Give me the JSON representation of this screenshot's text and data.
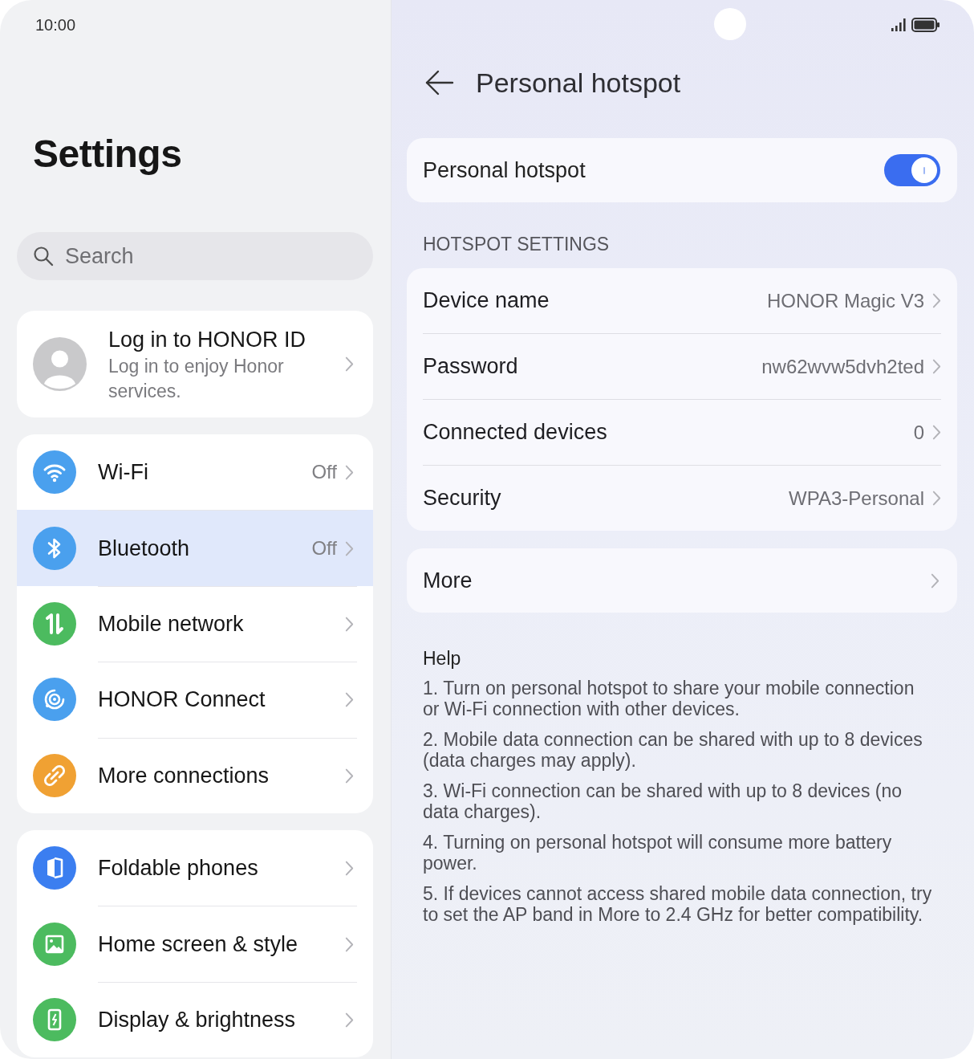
{
  "status_bar": {
    "time": "10:00"
  },
  "sidebar": {
    "title": "Settings",
    "search": {
      "placeholder": "Search"
    },
    "account": {
      "title": "Log in to HONOR ID",
      "subtitle": "Log in to enjoy Honor services."
    },
    "groups": [
      {
        "items": [
          {
            "kind": "wifi",
            "label": "Wi-Fi",
            "value": "Off",
            "selected": false
          },
          {
            "kind": "bluetooth",
            "label": "Bluetooth",
            "value": "Off",
            "selected": true
          },
          {
            "kind": "mobile",
            "label": "Mobile network",
            "selected": false
          },
          {
            "kind": "connect",
            "label": "HONOR Connect",
            "selected": false
          },
          {
            "kind": "link",
            "label": "More connections",
            "selected": false
          }
        ]
      },
      {
        "items": [
          {
            "kind": "foldable",
            "label": "Foldable phones",
            "selected": false
          },
          {
            "kind": "home",
            "label": "Home screen & style",
            "selected": false
          },
          {
            "kind": "display",
            "label": "Display & brightness",
            "selected": false
          }
        ]
      }
    ]
  },
  "page": {
    "title": "Personal hotspot",
    "master": {
      "label": "Personal hotspot",
      "on": true
    },
    "section_title": "HOTSPOT SETTINGS",
    "settings": [
      {
        "label": "Device name",
        "value": "HONOR Magic V3"
      },
      {
        "label": "Password",
        "value": "nw62wvw5dvh2ted"
      },
      {
        "label": "Connected devices",
        "value": "0"
      },
      {
        "label": "Security",
        "value": "WPA3-Personal"
      }
    ],
    "more": {
      "label": "More"
    },
    "help": {
      "title": "Help",
      "items": [
        "1. Turn on personal hotspot to share your mobile connection or Wi-Fi connection with other devices.",
        "2. Mobile data connection can be shared with up to 8 devices (data charges may apply).",
        "3. Wi-Fi connection can be shared with up to 8 devices (no data charges).",
        "4. Turning on personal hotspot will consume more battery power.",
        "5. If devices cannot access shared mobile data connection, try to set the AP band in More to 2.4 GHz for better compatibility."
      ]
    }
  }
}
